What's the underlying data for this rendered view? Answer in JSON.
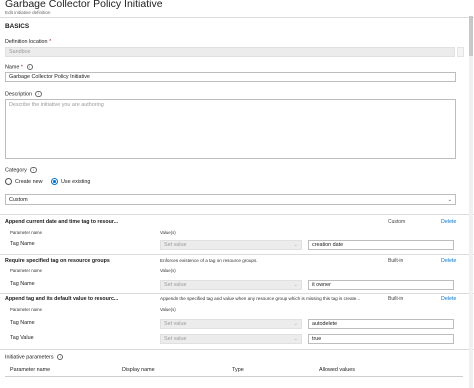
{
  "header": {
    "title": "Garbage Collector Policy Initiative",
    "subtitle": "Edit initiative definition"
  },
  "basics": {
    "heading": "BASICS",
    "definition_location": {
      "label": "Definition location",
      "required": "*",
      "value": "Sandbox"
    },
    "name": {
      "label": "Name",
      "required": "*",
      "value": "Garbage Collector Policy Initiative"
    },
    "description": {
      "label": "Description",
      "placeholder": "Describe the initiative you are authoring"
    },
    "category": {
      "label": "Category",
      "options": [
        "Create new",
        "Use existing"
      ],
      "selected": "Use existing",
      "value": "Custom"
    }
  },
  "policies": [
    {
      "name": "Append current date and time tag to resour...",
      "description": "",
      "type": "Custom",
      "delete_label": "Delete",
      "param_header": "Parameter name",
      "value_header": "Value(s)",
      "params": [
        {
          "name": "Tag Name",
          "select": "Set value",
          "value": "creation date"
        }
      ]
    },
    {
      "name": "Require specified tag on resource groups",
      "description": "Enforces existence of a tag on resource groups.",
      "type": "Built-in",
      "delete_label": "Delete",
      "param_header": "Parameter name",
      "value_header": "Value(s)",
      "params": [
        {
          "name": "Tag Name",
          "select": "Set value",
          "value": "it owner"
        }
      ]
    },
    {
      "name": "Append tag and its default value to resourc...",
      "description": "Appends the specified tag and value when any resource group which is missing this tag is create...",
      "type": "Built-in",
      "delete_label": "Delete",
      "param_header": "Parameter name",
      "value_header": "Value(s)",
      "params": [
        {
          "name": "Tag Name",
          "select": "Set value",
          "value": "autodelete"
        },
        {
          "name": "Tag Value",
          "select": "Set value",
          "value": "true"
        }
      ]
    }
  ],
  "initiative_parameters": {
    "label": "Initiative parameters",
    "columns": [
      "Parameter name",
      "Display name",
      "Type",
      "Allowed values"
    ]
  },
  "colors": {
    "accent": "#0078d4",
    "required": "#a4262c"
  }
}
